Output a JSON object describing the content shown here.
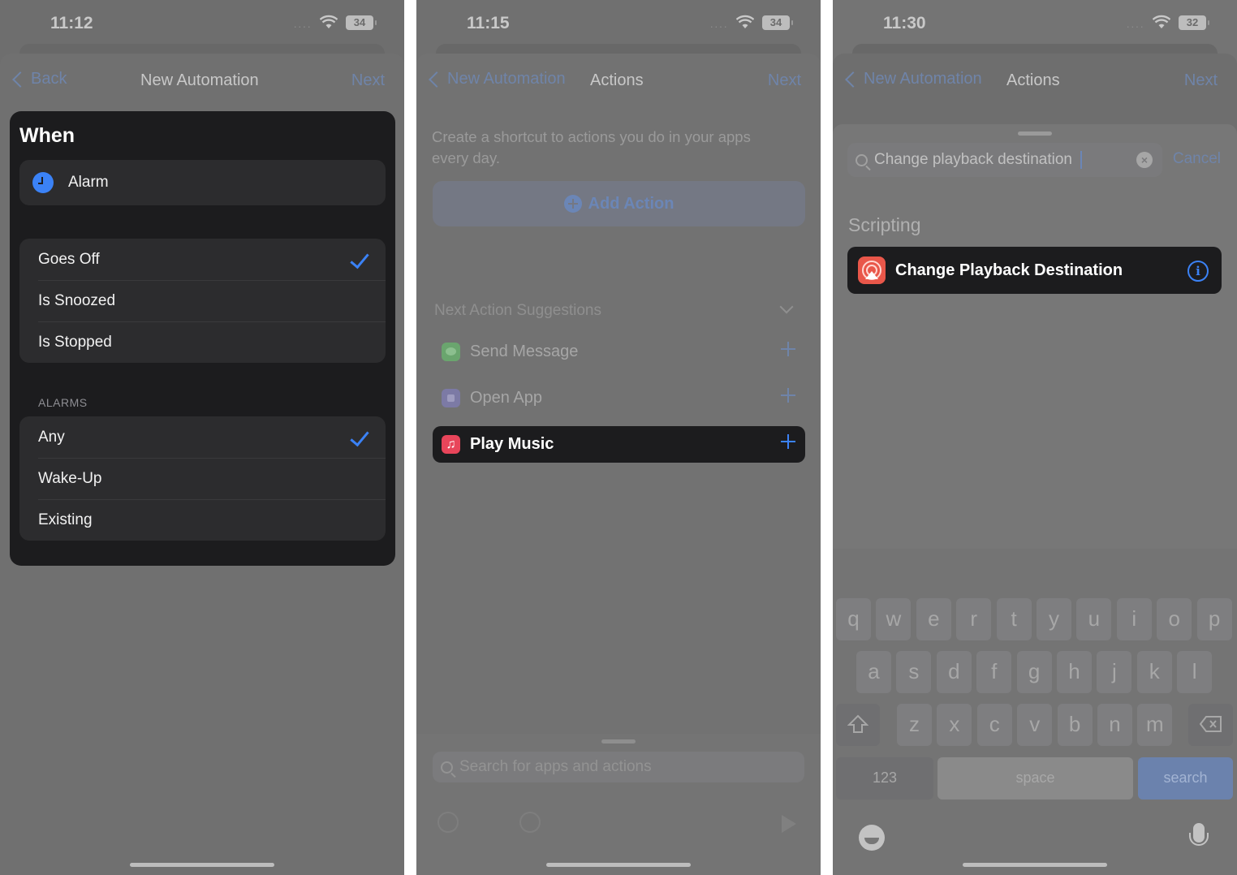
{
  "screens": [
    {
      "status": {
        "time": "11:12",
        "battery": "34"
      },
      "nav": {
        "back_label": "Back",
        "title": "New Automation",
        "next_label": "Next"
      },
      "when": {
        "title": "When",
        "trigger": {
          "label": "Alarm",
          "icon": "clock-icon"
        },
        "events": [
          {
            "label": "Goes Off",
            "selected": true
          },
          {
            "label": "Is Snoozed",
            "selected": false
          },
          {
            "label": "Is Stopped",
            "selected": false
          }
        ],
        "alarms_section_label": "ALARMS",
        "alarms": [
          {
            "label": "Any",
            "selected": true
          },
          {
            "label": "Wake-Up",
            "selected": false
          },
          {
            "label": "Existing",
            "selected": false
          }
        ]
      }
    },
    {
      "status": {
        "time": "11:15",
        "battery": "34"
      },
      "nav": {
        "back_label": "New Automation",
        "title": "Actions",
        "next_label": "Next"
      },
      "description": "Create a shortcut to actions you do in your apps every day.",
      "add_action_label": "Add Action",
      "suggestions_header": "Next Action Suggestions",
      "suggestions": [
        {
          "label": "Send Message",
          "icon": "messages-icon",
          "highlighted": false
        },
        {
          "label": "Open App",
          "icon": "open-app-icon",
          "highlighted": false
        },
        {
          "label": "Play Music",
          "icon": "music-icon",
          "highlighted": true
        }
      ],
      "search_placeholder": "Search for apps and actions"
    },
    {
      "status": {
        "time": "11:30",
        "battery": "32"
      },
      "nav": {
        "back_label": "New Automation",
        "title": "Actions",
        "next_label": "Next"
      },
      "search_value": "Change playback destination",
      "cancel_label": "Cancel",
      "section_label": "Scripting",
      "result": {
        "label": "Change Playback Destination",
        "icon": "airplay-icon"
      },
      "keyboard": {
        "row1": [
          "q",
          "w",
          "e",
          "r",
          "t",
          "y",
          "u",
          "i",
          "o",
          "p"
        ],
        "row2": [
          "a",
          "s",
          "d",
          "f",
          "g",
          "h",
          "j",
          "k",
          "l"
        ],
        "row3": [
          "z",
          "x",
          "c",
          "v",
          "b",
          "n",
          "m"
        ],
        "numbers_label": "123",
        "space_label": "space",
        "return_label": "search"
      }
    }
  ],
  "colors": {
    "accent": "#3b82f6",
    "music": "#e8455a",
    "airplay": "#e9574a",
    "card": "#1c1c1e"
  }
}
